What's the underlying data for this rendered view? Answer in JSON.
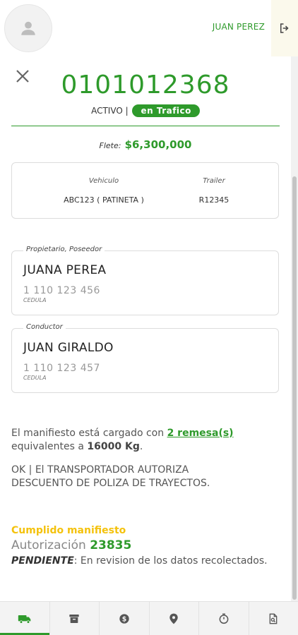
{
  "header": {
    "username": "JUAN PEREZ",
    "avatar_icon": "user-icon",
    "logout_icon": "logout-icon"
  },
  "manifest": {
    "code": "0101012368",
    "status": "ACTIVO |",
    "badge": "en Trafico",
    "flete_label": "Flete:",
    "flete_value": "$6,300,000"
  },
  "vehicle": {
    "vehicle_label": "Vehiculo",
    "vehicle_value": "ABC123 ( PATINETA )",
    "trailer_label": "Trailer",
    "trailer_value": "R12345"
  },
  "owner": {
    "legend": "Propietario, Poseedor",
    "name": "JUANA PEREA",
    "id": "1 110 123 456",
    "id_type": "CEDULA"
  },
  "driver": {
    "legend": "Conductor",
    "name": "JUAN GIRALDO",
    "id": "1 110 123 457",
    "id_type": "CEDULA"
  },
  "summary": {
    "text1": "El manifiesto está cargado con ",
    "remesas_link": "2 remesa(s)",
    "text2": "equivalentes a ",
    "weight": "16000 Kg",
    "text3": "."
  },
  "notice": "OK | El TRANSPORTADOR AUTORIZA DESCUENTO DE POLIZA DE TRAYECTOS.",
  "cumplido": {
    "title": "Cumplido manifiesto",
    "auth_label": "Autorización",
    "auth_number": "23835",
    "pending_label": "PENDIENTE",
    "pending_text": ": En revision de los datos recolectados."
  },
  "bottom_nav": [
    {
      "icon": "truck-icon"
    },
    {
      "icon": "archive-icon"
    },
    {
      "icon": "dollar-icon"
    },
    {
      "icon": "location-pin-icon"
    },
    {
      "icon": "stopwatch-icon"
    },
    {
      "icon": "document-search-icon"
    }
  ],
  "colors": {
    "primary": "#2e9a2b",
    "warning": "#f4c20d"
  }
}
